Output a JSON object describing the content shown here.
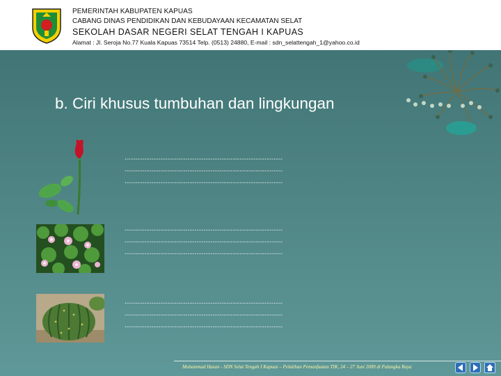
{
  "header": {
    "line1": "PEMERINTAH KABUPATEN KAPUAS",
    "line2": "CABANG DINAS PENDIDIKAN DAN KEBUDAYAAN KECAMATAN SELAT",
    "line3": "SEKOLAH DASAR NEGERI SELAT TENGAH I KAPUAS",
    "line4": "Alamat : Jl. Seroja No.77 Kuala Kapuas 73514 Telp. (0513) 24880, E-mail : sdn_selattengah_1@yahoo.co.id"
  },
  "slide": {
    "title": "b.  Ciri khusus tumbuhan dan lingkungan"
  },
  "blocks": [
    {
      "plant_icon": "rose-icon",
      "lines": [
        "........................................................................................",
        "........................................................................................",
        "........................................................................................"
      ]
    },
    {
      "plant_icon": "water-lily-icon",
      "lines": [
        "........................................................................................",
        "........................................................................................",
        "........................................................................................"
      ]
    },
    {
      "plant_icon": "cactus-icon",
      "lines": [
        "........................................................................................",
        "........................................................................................",
        "........................................................................................"
      ]
    }
  ],
  "footer": {
    "text": "Muhammad Hasan - SDN Selat Tengah I Kapuas – Pelatihan Pemanfaatan TIK, 24 – 27 Juni 2009 di Palangka Raya"
  },
  "nav": {
    "prev_icon": "arrow-left-icon",
    "next_icon": "arrow-right-icon",
    "home_icon": "home-icon"
  }
}
